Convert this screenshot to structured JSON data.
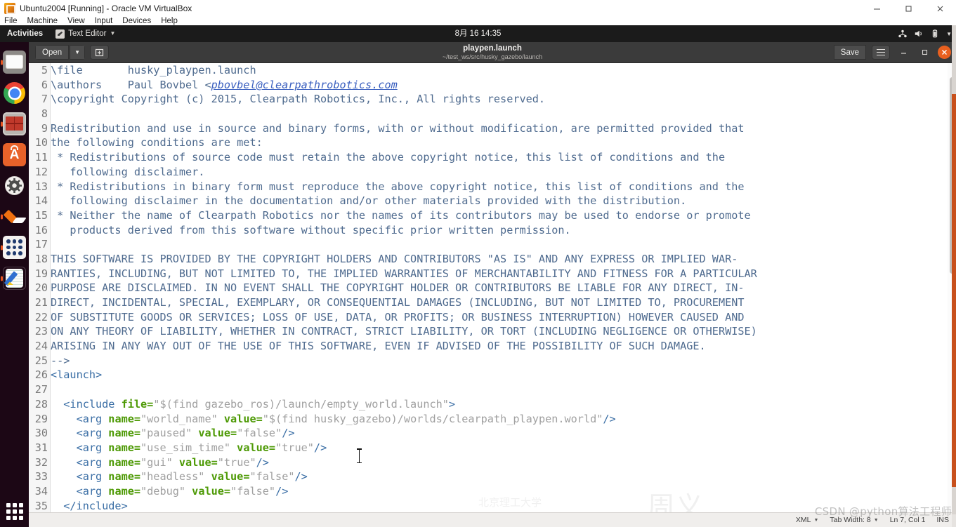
{
  "vbox": {
    "title": "Ubuntu2004 [Running] - Oracle VM VirtualBox",
    "icon": "virtualbox-icon",
    "menus": [
      "File",
      "Machine",
      "View",
      "Input",
      "Devices",
      "Help"
    ],
    "window_buttons": {
      "minimize": "minimize-icon",
      "maximize": "maximize-icon",
      "close": "close-icon"
    }
  },
  "gnome_topbar": {
    "activities": "Activities",
    "app_menu": "Text Editor",
    "app_menu_caret": "▼",
    "clock": "8月 16  14:35",
    "tray": {
      "network": "network-icon",
      "volume": "volume-icon",
      "battery": "battery-icon",
      "caret": "▼"
    }
  },
  "dock": {
    "items": [
      {
        "name": "files",
        "label": "Files"
      },
      {
        "name": "chrome",
        "label": "Google Chrome"
      },
      {
        "name": "redapp",
        "label": "Application"
      },
      {
        "name": "software",
        "label": "Ubuntu Software",
        "glyph": "A"
      },
      {
        "name": "settings",
        "label": "Settings"
      },
      {
        "name": "diamond",
        "label": "Help"
      },
      {
        "name": "grid",
        "label": "Application Grid"
      },
      {
        "name": "gedit",
        "label": "Text Editor",
        "active": true
      }
    ],
    "show_apps": "Show Applications"
  },
  "gedit": {
    "open_label": "Open",
    "open_caret": "▼",
    "new_tab_icon": "new-document-icon",
    "title": "playpen.launch",
    "subtitle": "~/test_ws/src/husky_gazebo/launch",
    "save_label": "Save",
    "menu_icon": "hamburger-menu-icon",
    "minimize_icon": "–",
    "maximize_icon": "❐",
    "close_icon": "✕"
  },
  "statusbar": {
    "language": "XML",
    "language_caret": "▼",
    "tab_width": "Tab Width: 8",
    "tab_caret": "▼",
    "position": "Ln 7, Col 1",
    "insert_mode": "INS"
  },
  "watermark": {
    "bottom_right": "CSDN @python算法工程师",
    "big": "周义",
    "mid": "北京理工大学"
  },
  "code": {
    "lines": [
      {
        "n": "5",
        "segments": [
          {
            "t": "\\file       husky_playpen.launch",
            "c": "c-comment"
          }
        ]
      },
      {
        "n": "6",
        "segments": [
          {
            "t": "\\authors    Paul Bovbel <",
            "c": "c-comment"
          },
          {
            "t": "pbovbel@clearpathrobotics.com",
            "c": "c-link"
          }
        ]
      },
      {
        "n": "7",
        "segments": [
          {
            "t": "\\copyright Copyright (c) 2015, Clearpath Robotics, Inc., All rights reserved.",
            "c": "c-comment"
          }
        ]
      },
      {
        "n": "8",
        "segments": [
          {
            "t": "",
            "c": "c-comment"
          }
        ]
      },
      {
        "n": "9",
        "segments": [
          {
            "t": "Redistribution and use in source and binary forms, with or without modification, are permitted provided that",
            "c": "c-comment"
          }
        ]
      },
      {
        "n": "10",
        "segments": [
          {
            "t": "the following conditions are met:",
            "c": "c-comment"
          }
        ]
      },
      {
        "n": "11",
        "segments": [
          {
            "t": " * Redistributions of source code must retain the above copyright notice, this list of conditions and the",
            "c": "c-comment"
          }
        ]
      },
      {
        "n": "12",
        "segments": [
          {
            "t": "   following disclaimer.",
            "c": "c-comment"
          }
        ]
      },
      {
        "n": "13",
        "segments": [
          {
            "t": " * Redistributions in binary form must reproduce the above copyright notice, this list of conditions and the",
            "c": "c-comment"
          }
        ]
      },
      {
        "n": "14",
        "segments": [
          {
            "t": "   following disclaimer in the documentation and/or other materials provided with the distribution.",
            "c": "c-comment"
          }
        ]
      },
      {
        "n": "15",
        "segments": [
          {
            "t": " * Neither the name of Clearpath Robotics nor the names of its contributors may be used to endorse or promote",
            "c": "c-comment"
          }
        ]
      },
      {
        "n": "16",
        "segments": [
          {
            "t": "   products derived from this software without specific prior written permission.",
            "c": "c-comment"
          }
        ]
      },
      {
        "n": "17",
        "segments": [
          {
            "t": "",
            "c": "c-comment"
          }
        ]
      },
      {
        "n": "18",
        "segments": [
          {
            "t": "THIS SOFTWARE IS PROVIDED BY THE COPYRIGHT HOLDERS AND CONTRIBUTORS \"AS IS\" AND ANY EXPRESS OR IMPLIED WAR-",
            "c": "c-comment"
          }
        ]
      },
      {
        "n": "19",
        "segments": [
          {
            "t": "RANTIES, INCLUDING, BUT NOT LIMITED TO, THE IMPLIED WARRANTIES OF MERCHANTABILITY AND FITNESS FOR A PARTICULAR",
            "c": "c-comment"
          }
        ]
      },
      {
        "n": "20",
        "segments": [
          {
            "t": "PURPOSE ARE DISCLAIMED. IN NO EVENT SHALL THE COPYRIGHT HOLDER OR CONTRIBUTORS BE LIABLE FOR ANY DIRECT, IN-",
            "c": "c-comment"
          }
        ]
      },
      {
        "n": "21",
        "segments": [
          {
            "t": "DIRECT, INCIDENTAL, SPECIAL, EXEMPLARY, OR CONSEQUENTIAL DAMAGES (INCLUDING, BUT NOT LIMITED TO, PROCUREMENT",
            "c": "c-comment"
          }
        ]
      },
      {
        "n": "22",
        "segments": [
          {
            "t": "OF SUBSTITUTE GOODS OR SERVICES; LOSS OF USE, DATA, OR PROFITS; OR BUSINESS INTERRUPTION) HOWEVER CAUSED AND",
            "c": "c-comment"
          }
        ]
      },
      {
        "n": "23",
        "segments": [
          {
            "t": "ON ANY THEORY OF LIABILITY, WHETHER IN CONTRACT, STRICT LIABILITY, OR TORT (INCLUDING NEGLIGENCE OR OTHERWISE)",
            "c": "c-comment"
          }
        ]
      },
      {
        "n": "24",
        "segments": [
          {
            "t": "ARISING IN ANY WAY OUT OF THE USE OF THIS SOFTWARE, EVEN IF ADVISED OF THE POSSIBILITY OF SUCH DAMAGE.",
            "c": "c-comment"
          }
        ]
      },
      {
        "n": "25",
        "segments": [
          {
            "t": "-->",
            "c": "c-comment"
          }
        ]
      },
      {
        "n": "26",
        "segments": [
          {
            "t": "<launch>",
            "c": "c-tag"
          }
        ]
      },
      {
        "n": "27",
        "segments": [
          {
            "t": "",
            "c": "c-plain"
          }
        ]
      },
      {
        "n": "28",
        "segments": [
          {
            "t": "  <include ",
            "c": "c-tag"
          },
          {
            "t": "file=",
            "c": "c-attr"
          },
          {
            "t": "\"$(find gazebo_ros)/launch/empty_world.launch\"",
            "c": "c-val"
          },
          {
            "t": ">",
            "c": "c-tag"
          }
        ]
      },
      {
        "n": "29",
        "segments": [
          {
            "t": "    <arg ",
            "c": "c-tag"
          },
          {
            "t": "name=",
            "c": "c-attr"
          },
          {
            "t": "\"world_name\" ",
            "c": "c-val"
          },
          {
            "t": "value=",
            "c": "c-attr"
          },
          {
            "t": "\"$(find husky_gazebo)/worlds/clearpath_playpen.world\"",
            "c": "c-val"
          },
          {
            "t": "/>",
            "c": "c-tag"
          }
        ]
      },
      {
        "n": "30",
        "segments": [
          {
            "t": "    <arg ",
            "c": "c-tag"
          },
          {
            "t": "name=",
            "c": "c-attr"
          },
          {
            "t": "\"paused\" ",
            "c": "c-val"
          },
          {
            "t": "value=",
            "c": "c-attr"
          },
          {
            "t": "\"false\"",
            "c": "c-val"
          },
          {
            "t": "/>",
            "c": "c-tag"
          }
        ]
      },
      {
        "n": "31",
        "segments": [
          {
            "t": "    <arg ",
            "c": "c-tag"
          },
          {
            "t": "name=",
            "c": "c-attr"
          },
          {
            "t": "\"use_sim_time\" ",
            "c": "c-val"
          },
          {
            "t": "value=",
            "c": "c-attr"
          },
          {
            "t": "\"true\"",
            "c": "c-val"
          },
          {
            "t": "/>",
            "c": "c-tag"
          }
        ]
      },
      {
        "n": "32",
        "segments": [
          {
            "t": "    <arg ",
            "c": "c-tag"
          },
          {
            "t": "name=",
            "c": "c-attr"
          },
          {
            "t": "\"gui\" ",
            "c": "c-val"
          },
          {
            "t": "value=",
            "c": "c-attr"
          },
          {
            "t": "\"true\"",
            "c": "c-val"
          },
          {
            "t": "/>",
            "c": "c-tag"
          }
        ]
      },
      {
        "n": "33",
        "segments": [
          {
            "t": "    <arg ",
            "c": "c-tag"
          },
          {
            "t": "name=",
            "c": "c-attr"
          },
          {
            "t": "\"headless\" ",
            "c": "c-val"
          },
          {
            "t": "value=",
            "c": "c-attr"
          },
          {
            "t": "\"false\"",
            "c": "c-val"
          },
          {
            "t": "/>",
            "c": "c-tag"
          }
        ]
      },
      {
        "n": "34",
        "segments": [
          {
            "t": "    <arg ",
            "c": "c-tag"
          },
          {
            "t": "name=",
            "c": "c-attr"
          },
          {
            "t": "\"debug\" ",
            "c": "c-val"
          },
          {
            "t": "value=",
            "c": "c-attr"
          },
          {
            "t": "\"false\"",
            "c": "c-val"
          },
          {
            "t": "/>",
            "c": "c-tag"
          }
        ]
      },
      {
        "n": "35",
        "segments": [
          {
            "t": "  </include>",
            "c": "c-tag"
          }
        ]
      }
    ]
  }
}
